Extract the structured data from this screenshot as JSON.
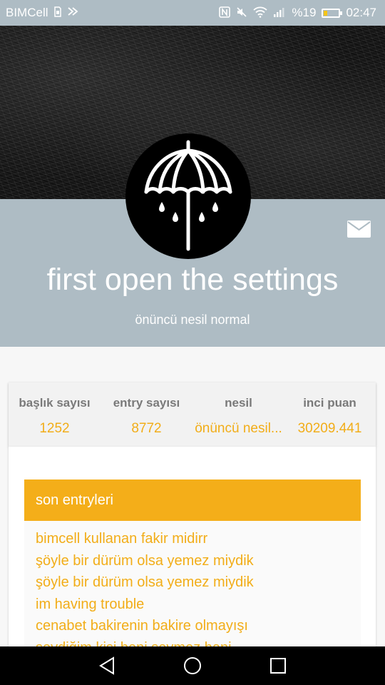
{
  "status_bar": {
    "carrier": "BIMCell",
    "battery_percent": "%19",
    "battery_level": 0.19,
    "time": "02:47",
    "icons": [
      "sim-icon",
      "data-saver-icon",
      "nfc-icon",
      "mute-icon",
      "wifi-icon",
      "signal-icon",
      "battery-icon"
    ]
  },
  "profile": {
    "username": "first open the settings",
    "generation": "önüncü nesil normal",
    "avatar_icon": "umbrella-icon",
    "message_icon": "mail-icon"
  },
  "stats": [
    {
      "label": "başlık sayısı",
      "value": "1252"
    },
    {
      "label": "entry sayısı",
      "value": "8772"
    },
    {
      "label": "nesil",
      "value": "önüncü nesil..."
    },
    {
      "label": "inci puan",
      "value": "30209.441"
    }
  ],
  "recent_entries": {
    "title": "son entryleri",
    "items": [
      "bimcell kullanan fakir midirr",
      "şöyle bir dürüm olsa yemez miydik",
      "şöyle bir dürüm olsa yemez miydik",
      "im having trouble",
      "cenabet bakirenin bakire olmayışı",
      "sevdiğim kişi beni sevmez hani"
    ]
  },
  "colors": {
    "accent": "#f4ae19",
    "band": "#aebcc4",
    "stat_label": "#7a7a7a"
  },
  "nav_bar": {
    "buttons": [
      "back-icon",
      "home-icon",
      "recents-icon"
    ]
  }
}
